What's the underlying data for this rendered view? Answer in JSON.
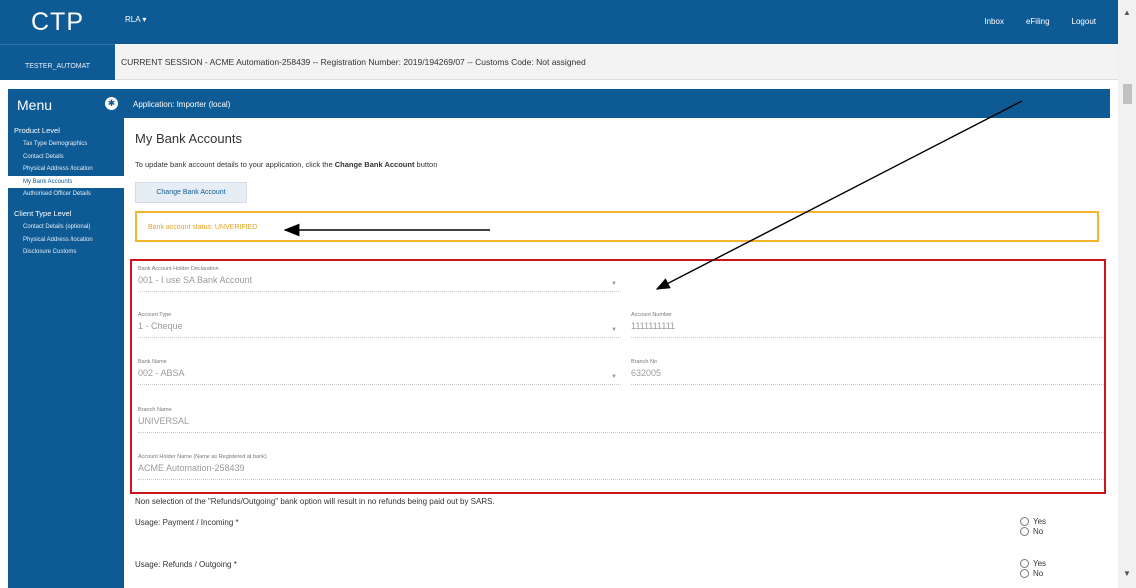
{
  "header": {
    "brand": "CTP",
    "username": "TESTER_AUTOMAT",
    "dropdown_label": "RLA ▾",
    "links": [
      "Inbox",
      "eFiling",
      "Logout"
    ]
  },
  "session": {
    "text": "CURRENT SESSION - ACME Automation-258439 -- Registration Number: 2019/194269/07 -- Customs Code: Not assigned"
  },
  "sidebar": {
    "title": "Menu",
    "sections": [
      {
        "label": "Product Level",
        "items": [
          "Tax Type Demographics",
          "Contact Details",
          "Physical Address /location",
          "My Bank Accounts",
          "Authorised Officer Details"
        ]
      },
      {
        "label": "Client Type Level",
        "items": [
          "Contact Details (optional)",
          "Physical Address /location",
          "Disclosure Customs"
        ]
      }
    ],
    "active_item": "My Bank Accounts"
  },
  "app_bar": {
    "label": "Application: Importer (local)"
  },
  "page": {
    "title": "My Bank Accounts",
    "intro_prefix": "To update bank account details to your application, click the ",
    "intro_bold": "Change Bank Account",
    "intro_suffix": " button",
    "change_button": "Change Bank Account",
    "status": "Bank account status: UNVERIFIED"
  },
  "form": {
    "holder_declaration": {
      "label": "Bank Account Holder Declaration",
      "value": "001 - I use SA Bank Account"
    },
    "account_type": {
      "label": "Account Type",
      "value": "1 - Cheque"
    },
    "account_number": {
      "label": "Account Number",
      "value": "1111111111"
    },
    "bank_name": {
      "label": "Bank Name",
      "value": "002 - ABSA"
    },
    "branch_no": {
      "label": "Branch No",
      "value": "632005"
    },
    "branch_name": {
      "label": "Branch Name",
      "value": "UNIVERSAL"
    },
    "holder_name": {
      "label": "Account Holder Name (Name as Registered at bank)",
      "value": "ACME Automation-258439"
    }
  },
  "usage": {
    "note": "Non selection of the \"Refunds/Outgoing\" bank option will result in no refunds being paid out by SARS.",
    "payment_label": "Usage: Payment / Incoming *",
    "refunds_label": "Usage: Refunds / Outgoing *",
    "yes": "Yes",
    "no": "No"
  },
  "colors": {
    "primary": "#0d5a95",
    "warning": "#f3b52d",
    "highlight": "#d0121b"
  }
}
